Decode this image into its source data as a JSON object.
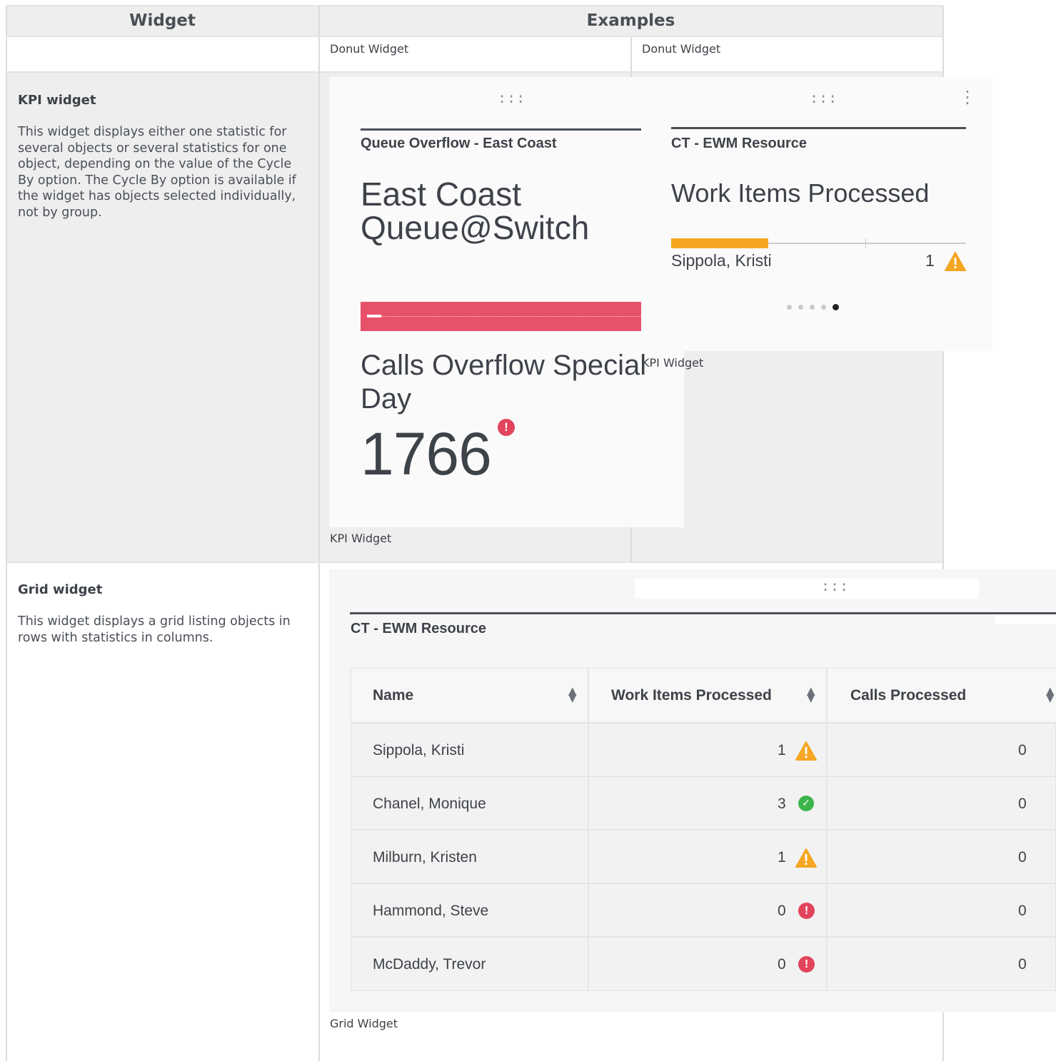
{
  "table": {
    "header": {
      "widget": "Widget",
      "examples": "Examples"
    },
    "donut_row": {
      "caption_left": "Donut Widget",
      "caption_right": "Donut Widget"
    },
    "kpi_row": {
      "title": "KPI widget",
      "description": "This widget displays either one statistic for several objects or several statistics for one object, depending on the value of the Cycle By option. The Cycle By option is available if the widget has objects selected individually, not by group.",
      "caption_left": "KPI Widget",
      "caption_right": "KPI Widget"
    },
    "grid_row": {
      "title": "Grid widget",
      "description": "This widget displays a grid listing objects in rows with statistics in columns.",
      "caption": "Grid Widget"
    }
  },
  "kpi_card_1": {
    "drag_icon": ":::",
    "subtitle": "Queue Overflow - East Coast",
    "object_line1": "East Coast",
    "object_line2": "Queue@Switch",
    "stat_line1": "Calls Overflow Special",
    "stat_line2": "Day",
    "value": "1766",
    "status": "error",
    "status_glyph": "!",
    "bar_color": "#e8516a"
  },
  "kpi_card_2": {
    "drag_icon": ":::",
    "menu_icon": "⋮",
    "subtitle": "CT - EWM Resource",
    "statistic": "Work Items Processed",
    "object": "Sippola, Kristi",
    "value": "1",
    "status": "warning",
    "status_glyph": "!",
    "progress": 0.33,
    "page_count": 5,
    "active_page": 5
  },
  "grid_widget": {
    "drag_icon": ":::",
    "subtitle": "CT - EWM Resource",
    "columns": [
      "Name",
      "Work Items Processed",
      "Calls Processed"
    ],
    "sort_icon": "⇕",
    "rows": [
      {
        "name": "Sippola, Kristi",
        "work_items": "1",
        "status": "warning",
        "glyph": "!",
        "calls": "0"
      },
      {
        "name": "Chanel, Monique",
        "work_items": "3",
        "status": "ok",
        "glyph": "✓",
        "calls": "0"
      },
      {
        "name": "Milburn, Kristen",
        "work_items": "1",
        "status": "warning",
        "glyph": "!",
        "calls": "0"
      },
      {
        "name": "Hammond, Steve",
        "work_items": "0",
        "status": "error",
        "glyph": "!",
        "calls": "0"
      },
      {
        "name": "McDaddy, Trevor",
        "work_items": "0",
        "status": "error",
        "glyph": "!",
        "calls": "0"
      }
    ]
  },
  "colors": {
    "warning": "#f5a623",
    "ok": "#3cb54a",
    "error": "#e2445c",
    "progress": "#f5a623"
  }
}
